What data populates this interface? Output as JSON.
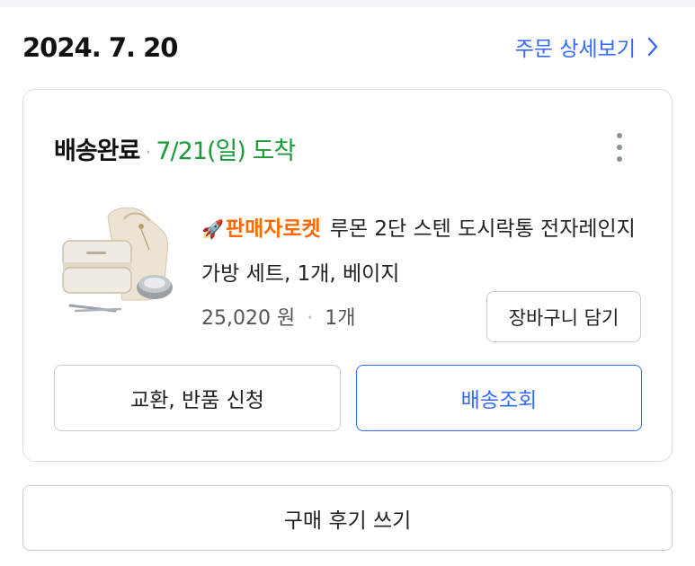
{
  "order": {
    "date": "2024. 7. 20",
    "detail_link_label": "주문 상세보기",
    "detail_link_icon": "chevron-right-icon",
    "accent_color": "#346aff"
  },
  "shipment": {
    "status": "배송완료",
    "separator": "·",
    "arrival": "7/21(일) 도착",
    "arrival_color": "#1c9b3a",
    "more_icon": "more-vertical-icon"
  },
  "product": {
    "badge_icon": "rocket-icon",
    "badge_label": "판매자로켓",
    "badge_color": "#ff6a00",
    "name": "루몬 2단 스텐 도시락통 전자레인지 가방 세트, 1개, 베이지",
    "price": "25,020 원",
    "separator": "·",
    "quantity": "1개",
    "cart_button": "장바구니 담기"
  },
  "actions": {
    "exchange_return": "교환, 반품 신청",
    "track_delivery": "배송조회",
    "write_review": "구매 후기 쓰기"
  }
}
